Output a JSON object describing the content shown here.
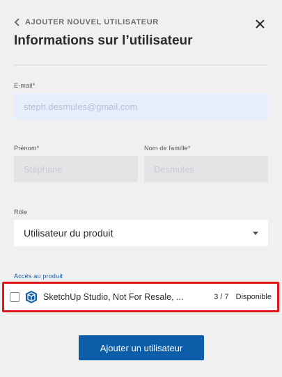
{
  "header": {
    "back_label": "AJOUTER NOUVEL UTILISATEUR",
    "title": "Informations sur l’utilisateur"
  },
  "form": {
    "email": {
      "label": "E-mail*",
      "value": "steph.desmules@gmail.com"
    },
    "first_name": {
      "label": "Prénom*",
      "value": "Stéphane"
    },
    "last_name": {
      "label": "Nom de famille*",
      "value": "Desmules"
    },
    "role": {
      "label": "Rôle",
      "value": "Utilisateur du produit"
    }
  },
  "access": {
    "label": "Accès au produit",
    "product": {
      "name": "SketchUp Studio, Not For Resale, ...",
      "count": "3 / 7",
      "status": "Disponible",
      "checked": false
    }
  },
  "actions": {
    "add_user_label": "Ajouter un utilisateur"
  },
  "colors": {
    "accent": "#0d5ea8",
    "highlight_border": "#e0161b",
    "email_field_bg": "#e6eefc"
  },
  "icons": {
    "back": "chevron-left-icon",
    "close": "close-icon",
    "dropdown": "caret-down-icon",
    "product": "sketchup-logo-icon"
  }
}
